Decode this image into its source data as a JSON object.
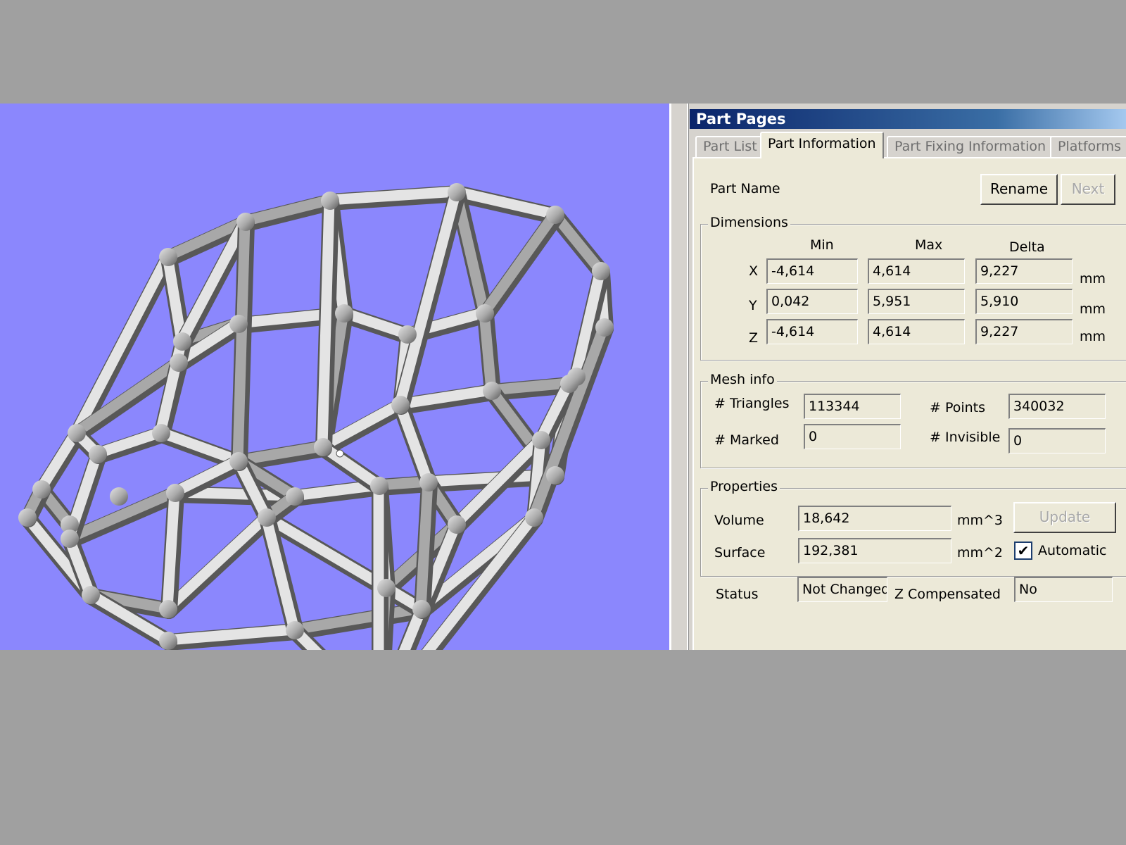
{
  "window": {
    "title": "Part Pages",
    "tabs": [
      {
        "label": "Part List",
        "active": false
      },
      {
        "label": "Part Information",
        "active": true
      },
      {
        "label": "Part Fixing Information",
        "active": false
      },
      {
        "label": "Platforms",
        "active": false
      }
    ]
  },
  "part": {
    "name_label": "Part Name",
    "rename_label": "Rename",
    "next_label": "Next"
  },
  "dimensions": {
    "title": "Dimensions",
    "col_min": "Min",
    "col_max": "Max",
    "col_delta": "Delta",
    "unit": "mm",
    "rows": [
      {
        "axis": "X",
        "min": "-4,614",
        "max": "4,614",
        "delta": "9,227"
      },
      {
        "axis": "Y",
        "min": "0,042",
        "max": "5,951",
        "delta": "5,910"
      },
      {
        "axis": "Z",
        "min": "-4,614",
        "max": "4,614",
        "delta": "9,227"
      }
    ]
  },
  "mesh": {
    "title": "Mesh info",
    "triangles_label": "# Triangles",
    "triangles": "113344",
    "points_label": "# Points",
    "points": "340032",
    "marked_label": "# Marked",
    "marked": "0",
    "invisible_label": "# Invisible",
    "invisible": "0"
  },
  "properties": {
    "title": "Properties",
    "volume_label": "Volume",
    "volume": "18,642",
    "volume_unit": "mm^3",
    "surface_label": "Surface",
    "surface": "192,381",
    "surface_unit": "mm^2",
    "update_label": "Update",
    "automatic_label": "Automatic",
    "automatic_checked": true,
    "check_mark": "✔"
  },
  "status": {
    "label": "Status",
    "value": "Not Changed",
    "zcomp_label": "Z Compensated",
    "zcomp_value": "No"
  },
  "colors": {
    "viewport_bg": "#8b87fd",
    "mesh_light": "#e4e4e4",
    "mesh_mid": "#a8a8a8",
    "mesh_dark": "#585858",
    "titlebar": "#0a246a"
  }
}
